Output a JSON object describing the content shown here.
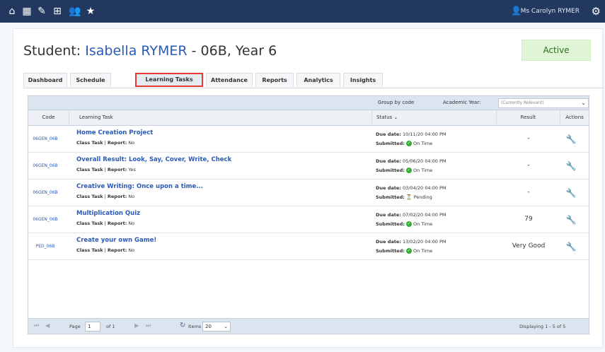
{
  "topbar": {
    "icons": [
      "home-icon",
      "grid-view-icon",
      "pencil-icon",
      "table-icon",
      "people-icon",
      "star-icon"
    ],
    "user_name": "Ms Carolyn RYMER"
  },
  "page": {
    "title_prefix": "Student:",
    "student_name": "Isabella RYMER",
    "title_suffix": "- 06B, Year 6",
    "status": "Active",
    "status_color": "#dff5d6"
  },
  "tabs": [
    {
      "label": "Dashboard",
      "active": false
    },
    {
      "label": "Schedule",
      "active": false
    },
    {
      "label": "Learning Tasks",
      "active": true
    },
    {
      "label": "Attendance",
      "active": false
    },
    {
      "label": "Reports",
      "active": false
    },
    {
      "label": "Analytics",
      "active": false
    },
    {
      "label": "Insights",
      "active": false
    }
  ],
  "toolbar": {
    "group_by": "Group by code",
    "academic_year_label": "Academic Year:",
    "academic_year_value": "(Currently Relevant)"
  },
  "columns": {
    "code": "Code",
    "task": "Learning Task",
    "status": "Status ⌄",
    "result": "Result",
    "actions": "Actions"
  },
  "rows": [
    {
      "code": "06GEN_06B",
      "name": "Home Creation Project",
      "task_type": "Class Task",
      "report_label": "Report:",
      "report": "No",
      "due_label": "Due date:",
      "due": "10/11/20 04:00 PM",
      "submitted_label": "Submitted:",
      "submitted": "On Time",
      "submitted_state": "ok",
      "result": "-"
    },
    {
      "code": "06GEN_06B",
      "name": "Overall Result: Look, Say, Cover, Write, Check",
      "task_type": "Class Task",
      "report_label": "Report:",
      "report": "Yes",
      "due_label": "Due date:",
      "due": "05/06/20 04:00 PM",
      "submitted_label": "Submitted:",
      "submitted": "On Time",
      "submitted_state": "ok",
      "result": "-"
    },
    {
      "code": "06GEN_06B",
      "name": "Creative Writing: Once upon a time...",
      "task_type": "Class Task",
      "report_label": "Report:",
      "report": "No",
      "due_label": "Due date:",
      "due": "03/04/20 04:00 PM",
      "submitted_label": "Submitted:",
      "submitted": "Pending",
      "submitted_state": "pending",
      "result": "-"
    },
    {
      "code": "06GEN_06B",
      "name": "Multiplication Quiz",
      "task_type": "Class Task",
      "report_label": "Report:",
      "report": "No",
      "due_label": "Due date:",
      "due": "07/02/20 04:00 PM",
      "submitted_label": "Submitted:",
      "submitted": "On Time",
      "submitted_state": "ok",
      "result": "79"
    },
    {
      "code": "PED_06B",
      "name": "Create your own Game!",
      "task_type": "Class Task",
      "report_label": "Report:",
      "report": "No",
      "due_label": "Due date:",
      "due": "13/02/20 04:00 PM",
      "submitted_label": "Submitted:",
      "submitted": "On Time",
      "submitted_state": "ok",
      "result": "Very Good"
    }
  ],
  "footer": {
    "page_label": "Page",
    "page_value": "1",
    "of_label": "of 1",
    "items_label": "Items",
    "items_value": "20",
    "displaying": "Displaying 1 - 5 of 5"
  }
}
